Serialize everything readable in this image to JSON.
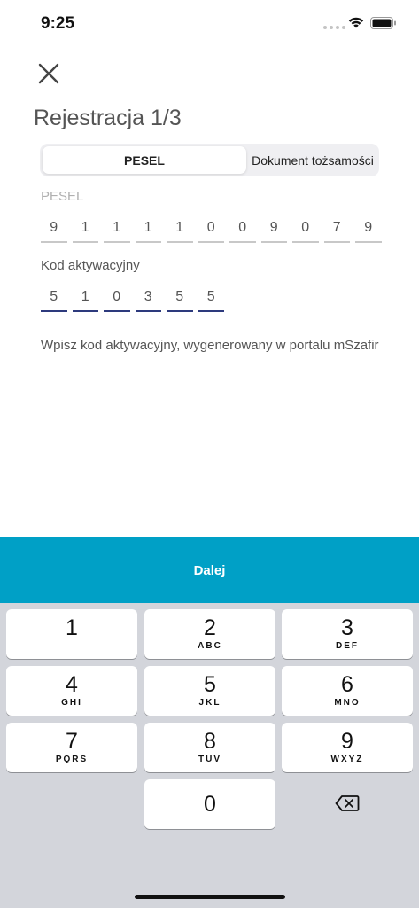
{
  "status_bar": {
    "time": "9:25",
    "icons": [
      "signal-icon",
      "wifi-icon",
      "battery-icon"
    ]
  },
  "header": {
    "close_icon": "close-icon",
    "title": "Rejestracja 1/3"
  },
  "tabs": [
    {
      "label": "PESEL",
      "active": true
    },
    {
      "label": "Dokument tożsamości",
      "active": false
    }
  ],
  "pesel": {
    "label": "PESEL",
    "digits": [
      "9",
      "1",
      "1",
      "1",
      "1",
      "0",
      "0",
      "9",
      "0",
      "7",
      "9"
    ]
  },
  "activation_code": {
    "label": "Kod aktywacyjny",
    "digits": [
      "5",
      "1",
      "0",
      "3",
      "5",
      "5"
    ],
    "helper": "Wpisz kod aktywacyjny, wygenerowany w portalu mSzafir"
  },
  "next_button": {
    "label": "Dalej"
  },
  "keypad": {
    "keys": [
      {
        "digit": "1",
        "letters": ""
      },
      {
        "digit": "2",
        "letters": "ABC"
      },
      {
        "digit": "3",
        "letters": "DEF"
      },
      {
        "digit": "4",
        "letters": "GHI"
      },
      {
        "digit": "5",
        "letters": "JKL"
      },
      {
        "digit": "6",
        "letters": "MNO"
      },
      {
        "digit": "7",
        "letters": "PQRS"
      },
      {
        "digit": "8",
        "letters": "TUV"
      },
      {
        "digit": "9",
        "letters": "WXYZ"
      },
      {
        "digit": "0",
        "letters": ""
      }
    ],
    "backspace_icon": "backspace-icon"
  },
  "colors": {
    "accent": "#00a0c6",
    "code_underline": "#2d3a7d",
    "keypad_bg": "#d3d5db"
  }
}
